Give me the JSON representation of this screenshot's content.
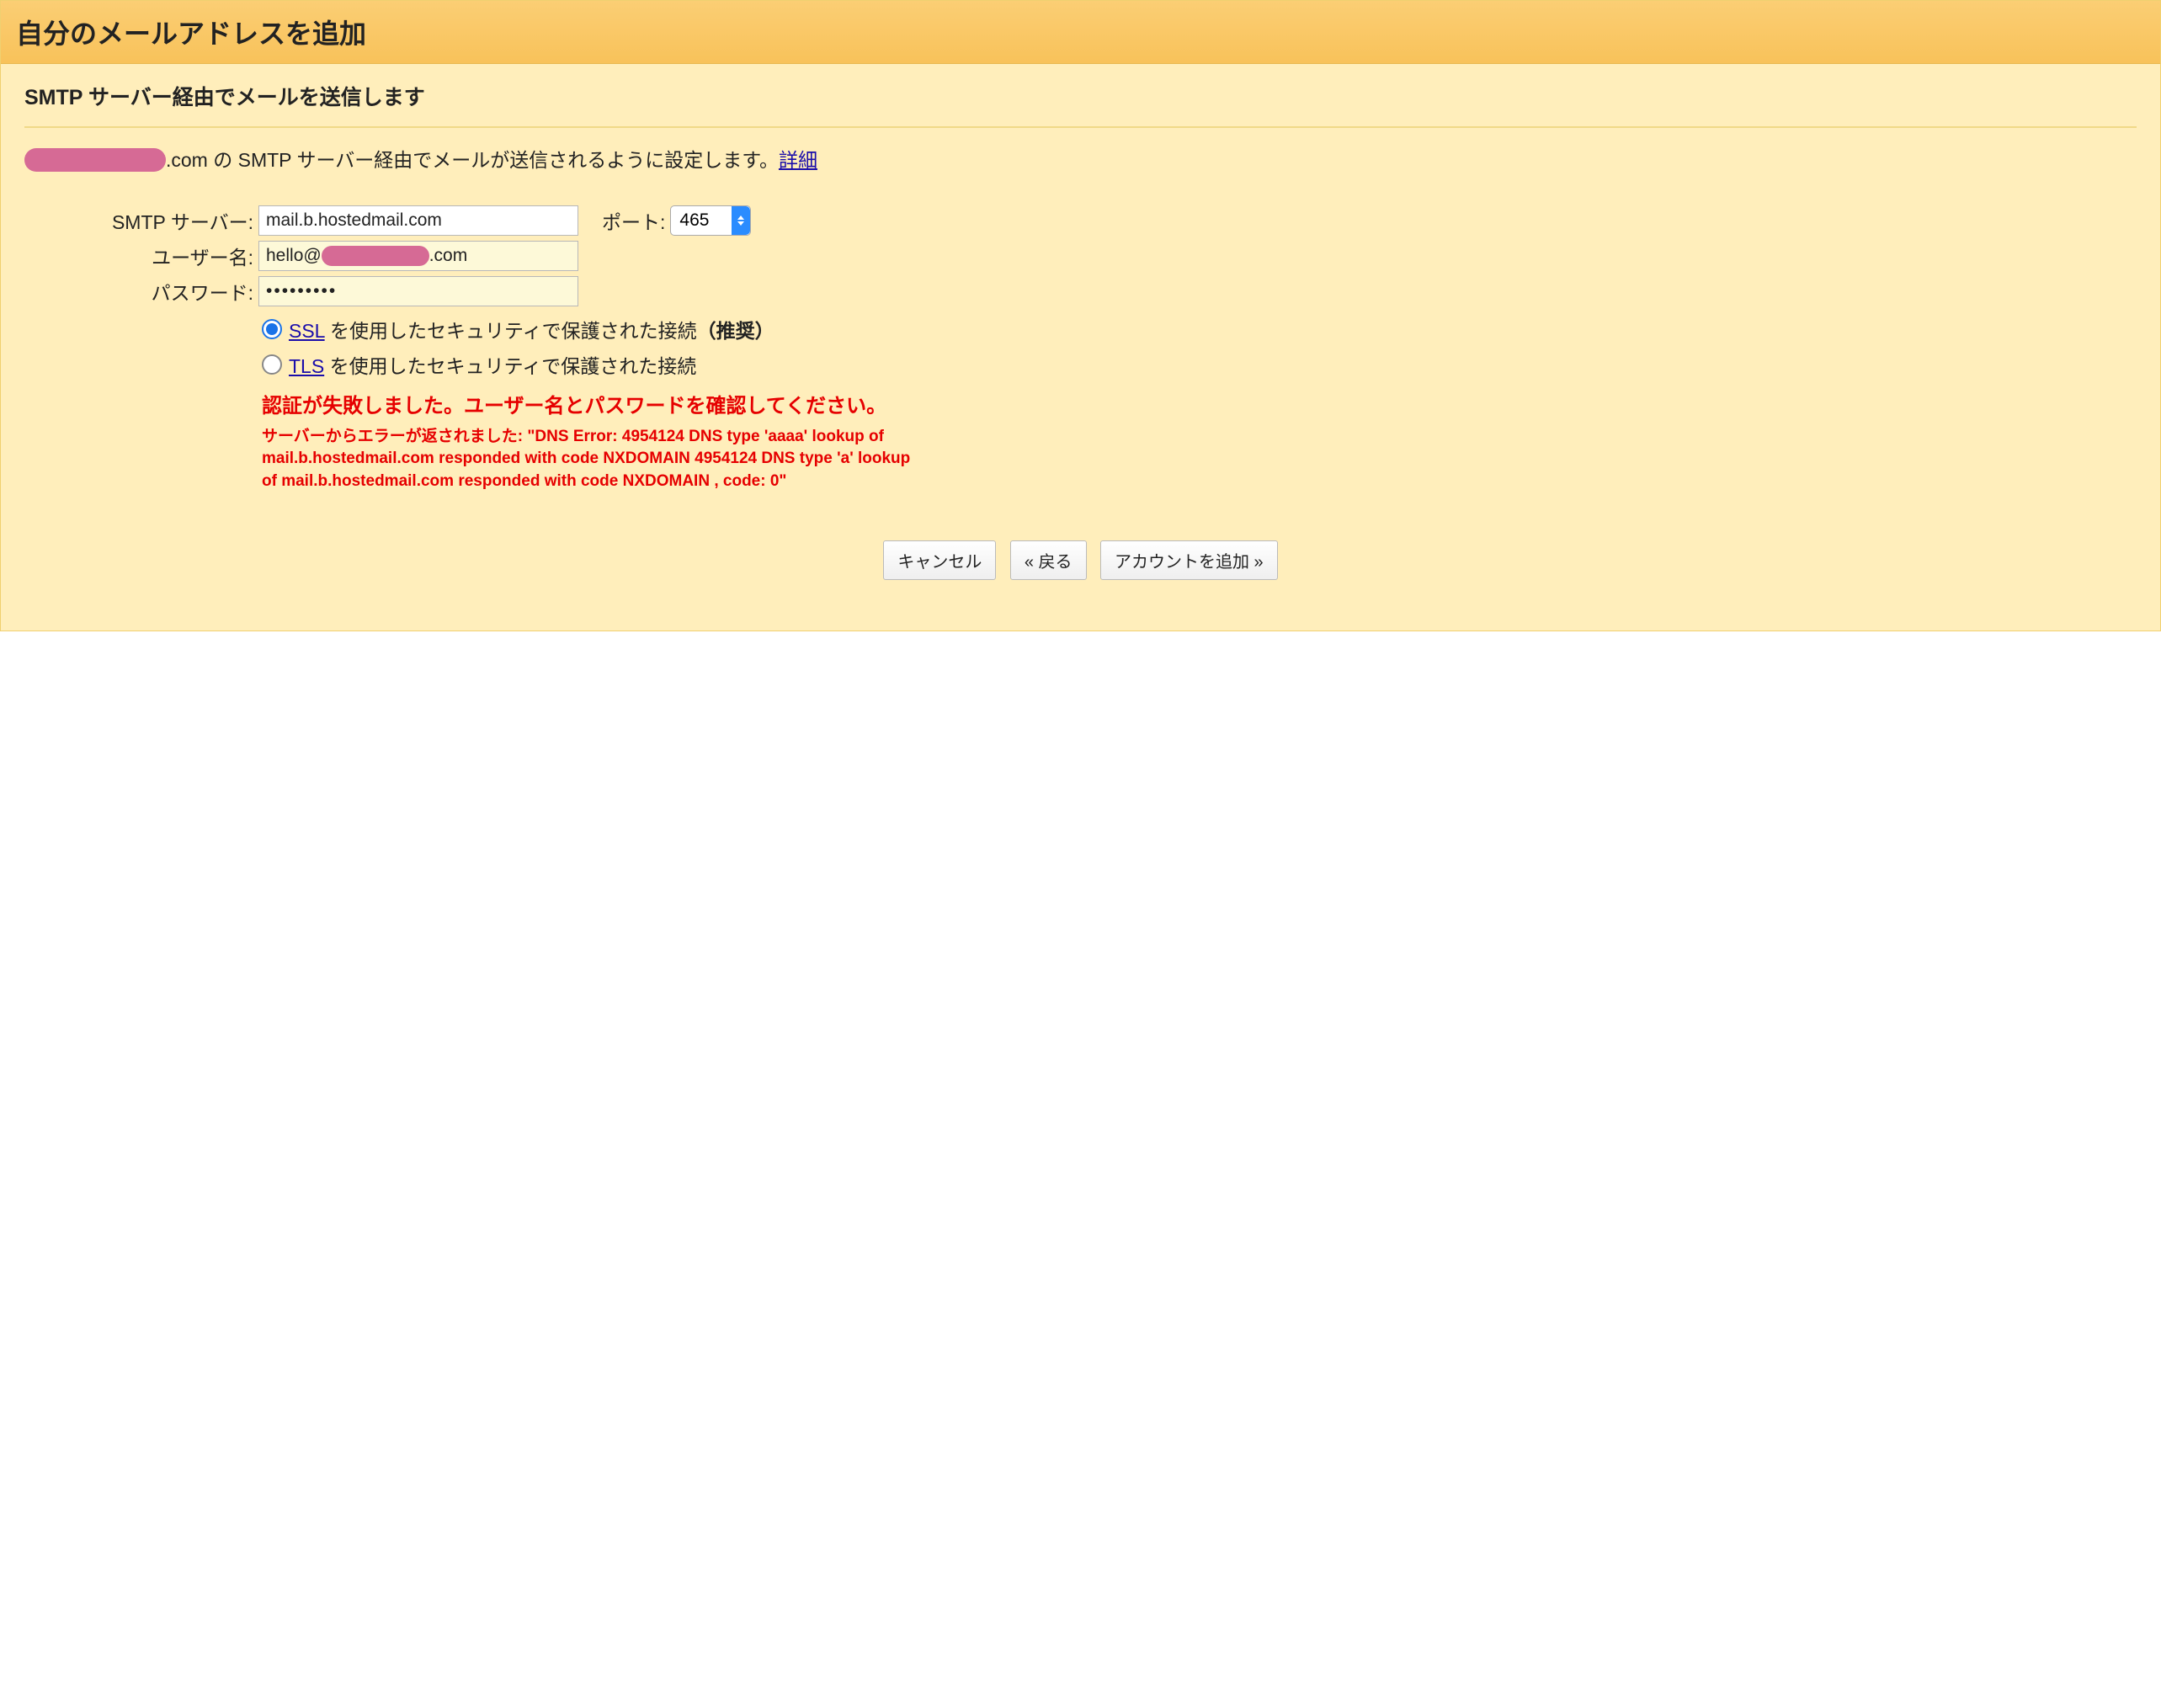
{
  "titlebar": {
    "title": "自分のメールアドレスを追加"
  },
  "section": {
    "heading": "SMTP サーバー経由でメールを送信します"
  },
  "description": {
    "domain_suffix": ".com",
    "text_after": " の SMTP サーバー経由でメールが送信されるように設定します。",
    "details_link": "詳細"
  },
  "form": {
    "smtp_label": "SMTP サーバー:",
    "smtp_value": "mail.b.hostedmail.com",
    "port_label": "ポート:",
    "port_value": "465",
    "user_label": "ユーザー名:",
    "user_prefix": "hello@",
    "user_suffix": ".com",
    "password_label": "パスワード:",
    "password_masked": "•••••••••"
  },
  "security": {
    "ssl_link": "SSL",
    "ssl_text": " を使用したセキュリティで保護された接続",
    "ssl_recommended": "（推奨）",
    "tls_link": "TLS",
    "tls_text": " を使用したセキュリティで保護された接続"
  },
  "error": {
    "heading": "認証が失敗しました。ユーザー名とパスワードを確認してください。",
    "detail": "サーバーからエラーが返されました: \"DNS Error: 4954124 DNS type 'aaaa' lookup of mail.b.hostedmail.com responded with code NXDOMAIN 4954124 DNS type 'a' lookup of mail.b.hostedmail.com responded with code NXDOMAIN , code: 0\""
  },
  "buttons": {
    "cancel": "キャンセル",
    "back": "« 戻る",
    "add": "アカウントを追加 »"
  }
}
